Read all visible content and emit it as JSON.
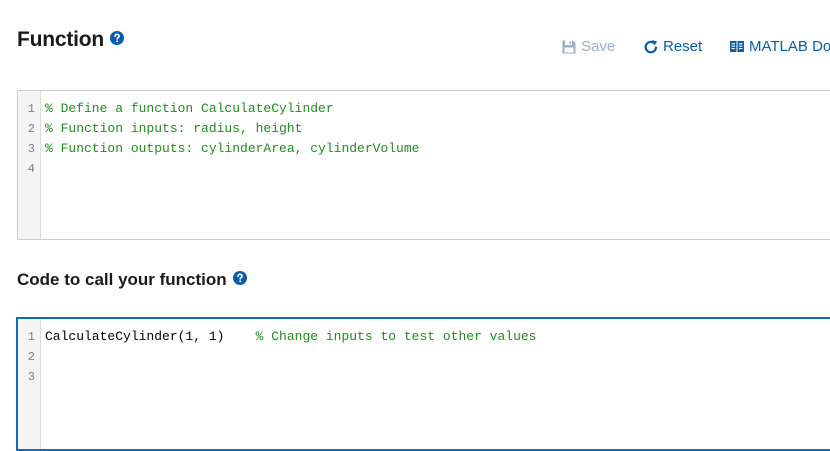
{
  "header": {
    "title": "Function"
  },
  "toolbar": {
    "save_label": "Save",
    "reset_label": "Reset",
    "doc_label": "MATLAB Do"
  },
  "function_editor": {
    "lines": [
      {
        "number": "1",
        "code": "",
        "comment": "% Define a function CalculateCylinder"
      },
      {
        "number": "2",
        "code": "",
        "comment": "% Function inputs: radius, height"
      },
      {
        "number": "3",
        "code": "",
        "comment": "% Function outputs: cylinderArea, cylinderVolume"
      },
      {
        "number": "4",
        "code": "",
        "comment": ""
      }
    ]
  },
  "call_section": {
    "title": "Code to call your function"
  },
  "call_editor": {
    "lines": [
      {
        "number": "1",
        "code": "CalculateCylinder(1, 1)    ",
        "comment": "% Change inputs to test other values"
      },
      {
        "number": "2",
        "code": "",
        "comment": ""
      },
      {
        "number": "3",
        "code": "",
        "comment": ""
      }
    ]
  },
  "colors": {
    "accent": "#0a5ea8",
    "disabled": "#9ab0c6",
    "comment": "#228b22",
    "active_border": "#0a6ebd"
  },
  "icons": {
    "help": "question-circle-icon",
    "save": "floppy-disk-icon",
    "reset": "refresh-icon",
    "doc": "book-icon"
  }
}
